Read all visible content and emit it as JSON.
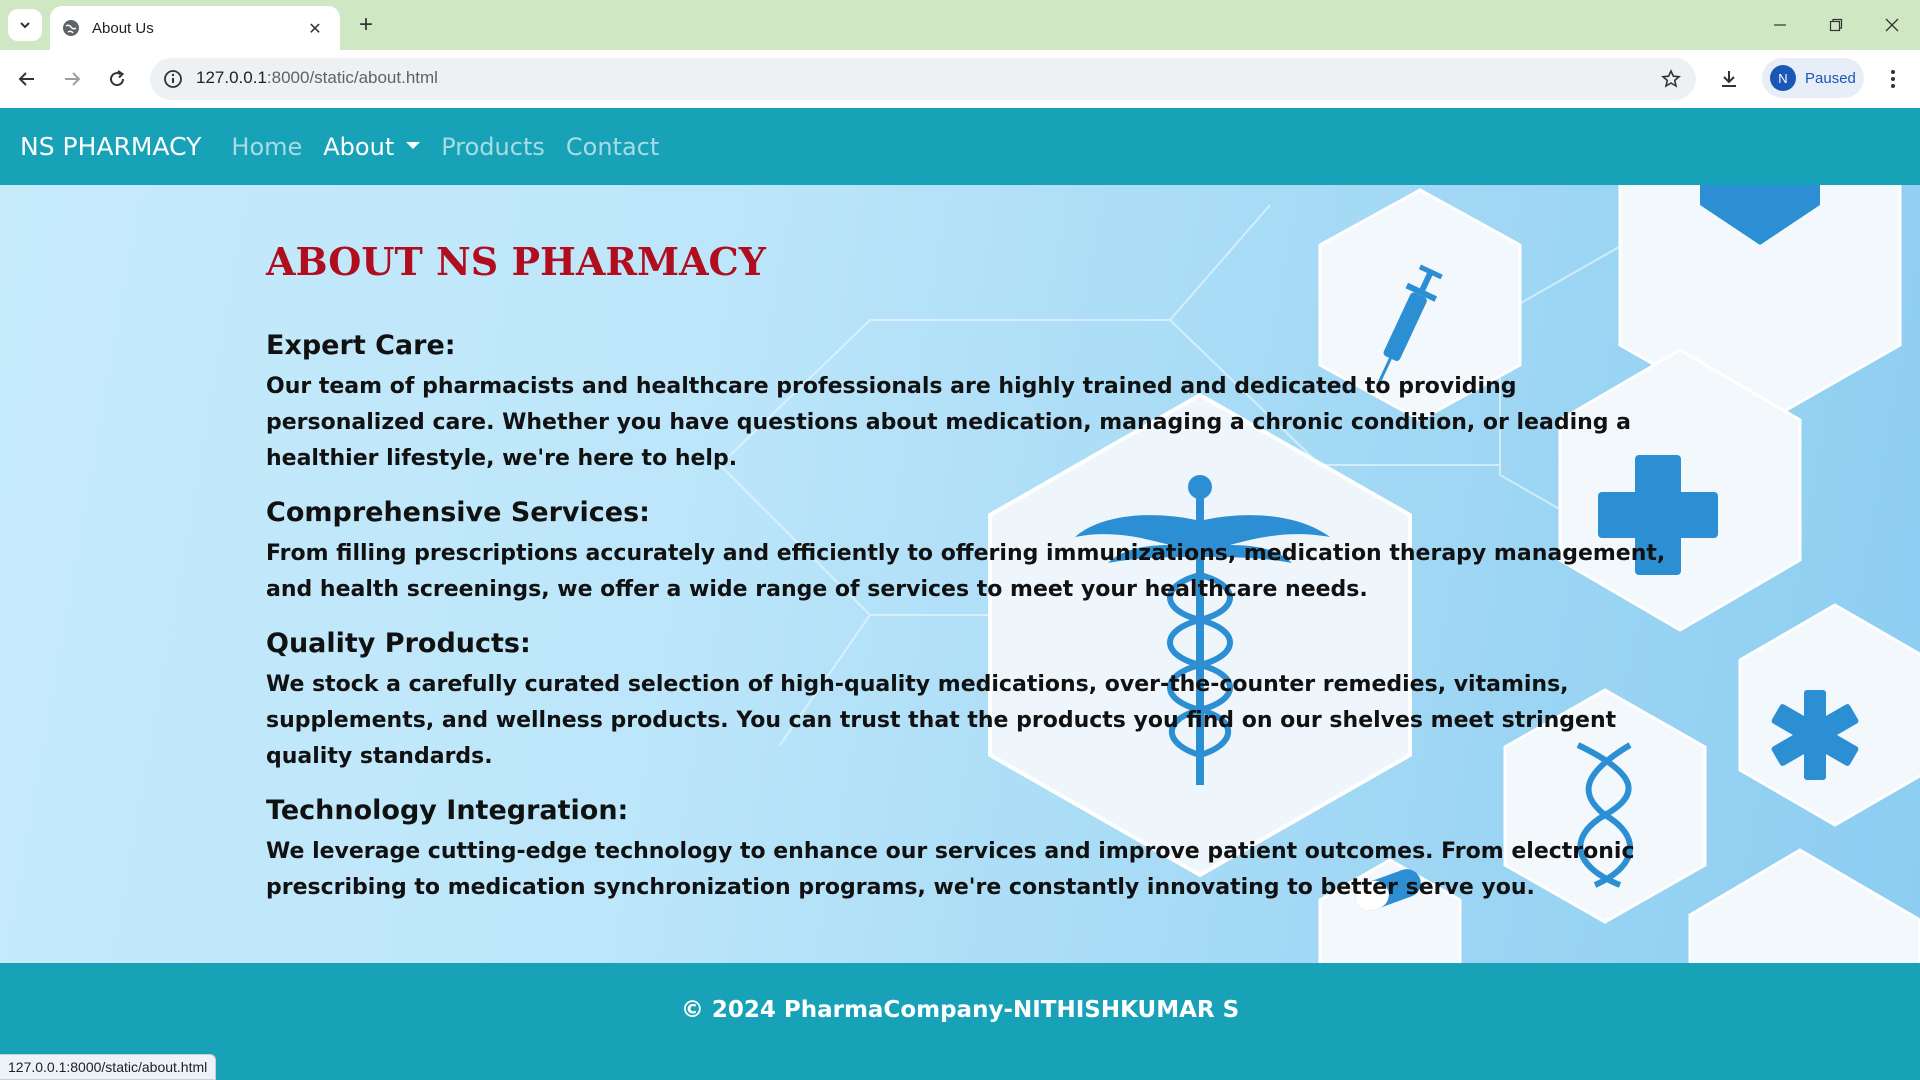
{
  "browser": {
    "tab_title": "About Us",
    "url_host": "127.0.0.1",
    "url_rest": ":8000/static/about.html",
    "profile_initial": "N",
    "profile_label": "Paused",
    "status_url": "127.0.0.1:8000/static/about.html"
  },
  "nav": {
    "brand": "NS PHARMACY",
    "links": [
      {
        "label": "Home",
        "active": false
      },
      {
        "label": "About",
        "active": true,
        "dropdown": true
      },
      {
        "label": "Products",
        "active": false
      },
      {
        "label": "Contact",
        "active": false
      }
    ]
  },
  "about": {
    "title": "ABOUT NS PHARMACY",
    "sections": [
      {
        "heading": "Expert Care:",
        "body": "Our team of pharmacists and healthcare professionals are highly trained and dedicated to providing personalized care. Whether you have questions about medication, managing a chronic condition, or leading a healthier lifestyle, we're here to help."
      },
      {
        "heading": "Comprehensive Services:",
        "body": "From filling prescriptions accurately and efficiently to offering immunizations, medication therapy management, and health screenings, we offer a wide range of services to meet your healthcare needs."
      },
      {
        "heading": "Quality Products:",
        "body": "We stock a carefully curated selection of high-quality medications, over-the-counter remedies, vitamins, supplements, and wellness products. You can trust that the products you find on our shelves meet stringent quality standards."
      },
      {
        "heading": "Technology Integration:",
        "body": "We leverage cutting-edge technology to enhance our services and improve patient outcomes. From electronic prescribing to medication synchronization programs, we're constantly innovating to better serve you."
      }
    ]
  },
  "footer": {
    "text": "© 2024 PharmaCompany-NITHISHKUMAR S"
  },
  "colors": {
    "navbar": "#17a2b8",
    "title_red": "#b00d1f",
    "tabbar": "#cfe8c3"
  }
}
